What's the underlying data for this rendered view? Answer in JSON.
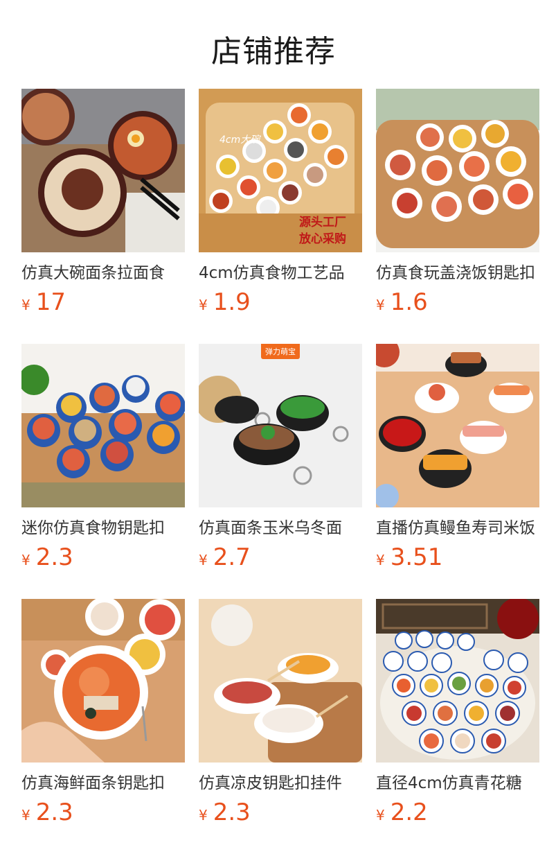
{
  "page": {
    "title": "店铺推荐"
  },
  "products": [
    {
      "name": "仿真大碗面条拉面食",
      "currency": "¥",
      "price": "17"
    },
    {
      "name": "4cm仿真食物工艺品",
      "currency": "¥",
      "price": "1.9"
    },
    {
      "name": "仿真食玩盖浇饭钥匙扣",
      "currency": "¥",
      "price": "1.6"
    },
    {
      "name": "迷你仿真食物钥匙扣",
      "currency": "¥",
      "price": "2.3"
    },
    {
      "name": "仿真面条玉米乌冬面",
      "currency": "¥",
      "price": "2.7"
    },
    {
      "name": "直播仿真鳗鱼寿司米饭",
      "currency": "¥",
      "price": "3.51"
    },
    {
      "name": "仿真海鲜面条钥匙扣",
      "currency": "¥",
      "price": "2.3"
    },
    {
      "name": "仿真凉皮钥匙扣挂件",
      "currency": "¥",
      "price": "2.3"
    },
    {
      "name": "直径4cm仿真青花糖",
      "currency": "¥",
      "price": "2.2"
    }
  ],
  "image_overlays": {
    "p2_watermark": "4cm大碗",
    "p2_banner_line1": "源头工厂",
    "p2_banner_line2": "放心采购",
    "p5_badge": "弹力萌宝"
  },
  "colors": {
    "price": "#e8501c",
    "title": "#1a1a1a",
    "text": "#333333"
  }
}
